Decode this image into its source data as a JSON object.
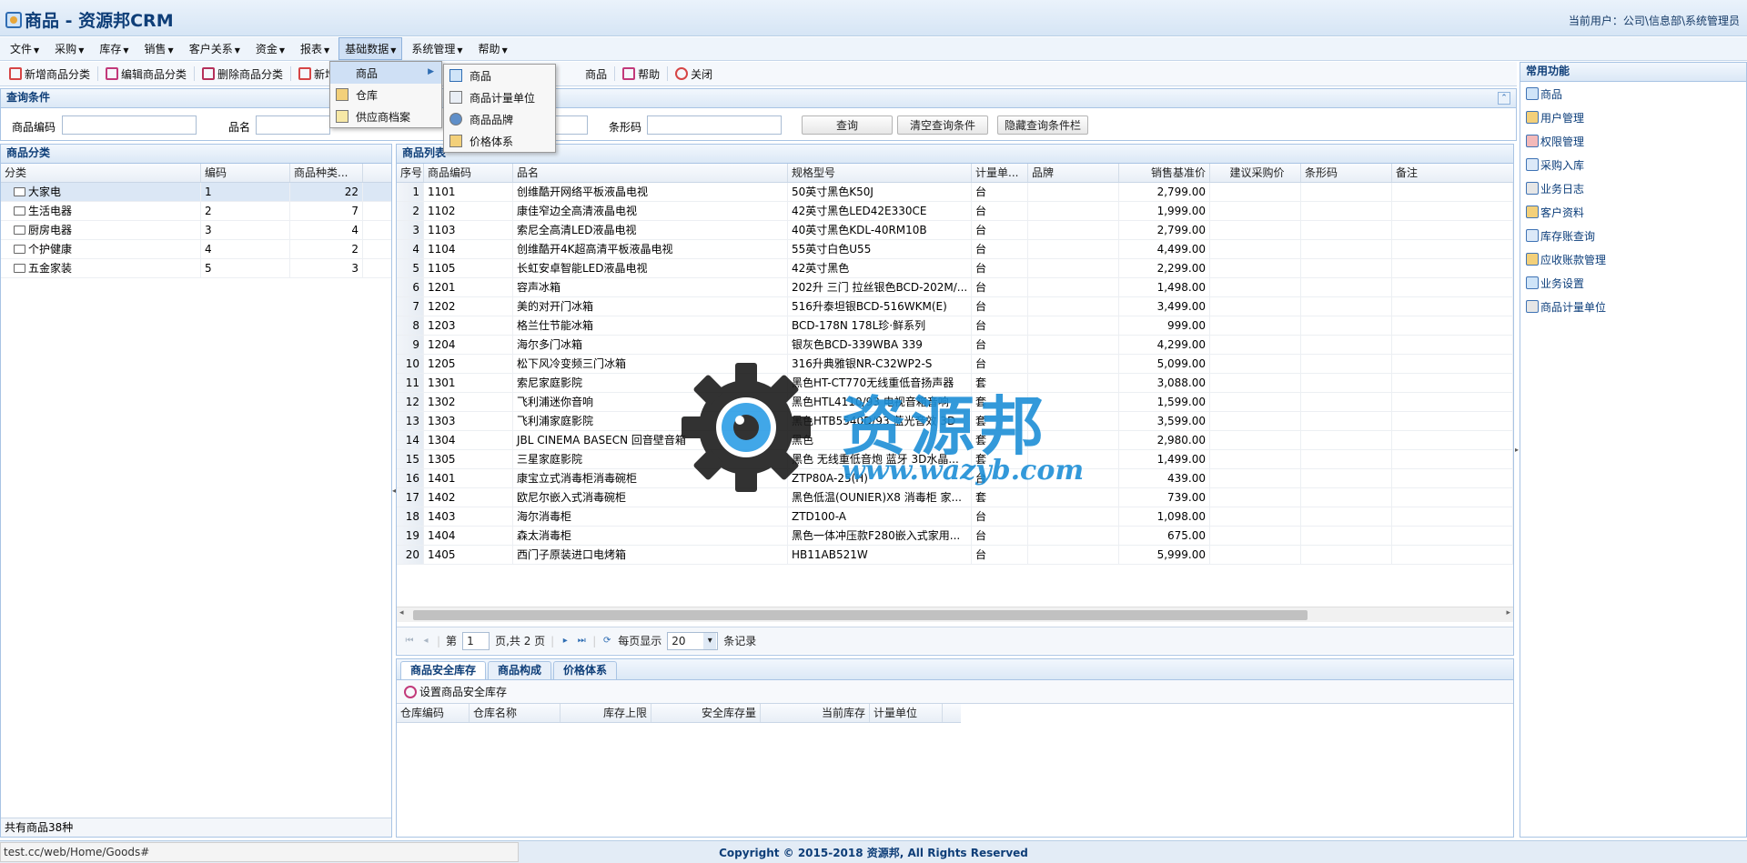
{
  "app": {
    "title": "商品 - 资源邦CRM",
    "user": "当前用户：公司\\信息部\\系统管理员"
  },
  "menu": [
    {
      "label": "文件"
    },
    {
      "label": "采购"
    },
    {
      "label": "库存"
    },
    {
      "label": "销售"
    },
    {
      "label": "客户关系"
    },
    {
      "label": "资金"
    },
    {
      "label": "报表"
    },
    {
      "label": "基础数据"
    },
    {
      "label": "系统管理"
    },
    {
      "label": "帮助"
    }
  ],
  "toolbar": {
    "add_category": "新增商品分类",
    "edit_category": "编辑商品分类",
    "delete_category": "删除商品分类",
    "add_goods": "新增",
    "goods_partial": "商品",
    "help": "帮助",
    "close": "关闭"
  },
  "dropdown": {
    "level1": [
      {
        "label": "商品"
      },
      {
        "label": "仓库"
      },
      {
        "label": "供应商档案"
      }
    ],
    "level2": [
      {
        "label": "商品"
      },
      {
        "label": "商品计量单位"
      },
      {
        "label": "商品品牌"
      },
      {
        "label": "价格体系"
      }
    ]
  },
  "query": {
    "title": "查询条件",
    "code_label": "商品编码",
    "name_label": "品名",
    "barcode_label": "条形码",
    "search": "查询",
    "clear": "清空查询条件",
    "hide": "隐藏查询条件栏"
  },
  "category": {
    "title": "商品分类",
    "headers": [
      "分类",
      "编码",
      "商品种类..."
    ],
    "rows": [
      {
        "name": "大家电",
        "code": "1",
        "count": "22"
      },
      {
        "name": "生活电器",
        "code": "2",
        "count": "7"
      },
      {
        "name": "厨房电器",
        "code": "3",
        "count": "4"
      },
      {
        "name": "个护健康",
        "code": "4",
        "count": "2"
      },
      {
        "name": "五金家装",
        "code": "5",
        "count": "3"
      }
    ],
    "footer": "共有商品38种"
  },
  "goods": {
    "title": "商品列表",
    "headers": [
      "序号",
      "商品编码",
      "品名",
      "规格型号",
      "计量单...",
      "品牌",
      "销售基准价",
      "建议采购价",
      "条形码",
      "备注"
    ],
    "rows": [
      {
        "no": "1",
        "code": "1101",
        "name": "创维酷开网络平板液晶电视",
        "spec": "50英寸黑色K50J",
        "unit": "台",
        "price": "2,799.00"
      },
      {
        "no": "2",
        "code": "1102",
        "name": "康佳窄边全高清液晶电视",
        "spec": "42英寸黑色LED42E330CE",
        "unit": "台",
        "price": "1,999.00"
      },
      {
        "no": "3",
        "code": "1103",
        "name": "索尼全高清LED液晶电视",
        "spec": "40英寸黑色KDL-40RM10B",
        "unit": "台",
        "price": "2,799.00"
      },
      {
        "no": "4",
        "code": "1104",
        "name": "创维酷开4K超高清平板液晶电视",
        "spec": "55英寸白色U55",
        "unit": "台",
        "price": "4,499.00"
      },
      {
        "no": "5",
        "code": "1105",
        "name": "长虹安卓智能LED液晶电视",
        "spec": "42英寸黑色",
        "unit": "台",
        "price": "2,299.00"
      },
      {
        "no": "6",
        "code": "1201",
        "name": "容声冰箱",
        "spec": "202升 三门 拉丝银色BCD-202M/...",
        "unit": "台",
        "price": "1,498.00"
      },
      {
        "no": "7",
        "code": "1202",
        "name": "美的对开门冰箱",
        "spec": "516升泰坦银BCD-516WKM(E)",
        "unit": "台",
        "price": "3,499.00"
      },
      {
        "no": "8",
        "code": "1203",
        "name": "格兰仕节能冰箱",
        "spec": "BCD-178N 178L珍·鲜系列",
        "unit": "台",
        "price": "999.00"
      },
      {
        "no": "9",
        "code": "1204",
        "name": "海尔多门冰箱",
        "spec": "银灰色BCD-339WBA 339",
        "unit": "台",
        "price": "4,299.00"
      },
      {
        "no": "10",
        "code": "1205",
        "name": "松下风冷变频三门冰箱",
        "spec": "316升典雅银NR-C32WP2-S",
        "unit": "台",
        "price": "5,099.00"
      },
      {
        "no": "11",
        "code": "1301",
        "name": "索尼家庭影院",
        "spec": "黑色HT-CT770无线重低音扬声器",
        "unit": "套",
        "price": "3,088.00"
      },
      {
        "no": "12",
        "code": "1302",
        "name": "飞利浦迷你音响",
        "spec": "黑色HTL4110/93 电视音箱音响",
        "unit": "套",
        "price": "1,599.00"
      },
      {
        "no": "13",
        "code": "1303",
        "name": "飞利浦家庭影院",
        "spec": "黑色HTB5540D/93 蓝光音效 3D",
        "unit": "套",
        "price": "3,599.00"
      },
      {
        "no": "14",
        "code": "1304",
        "name": "JBL CINEMA BASECN 回音壁音箱",
        "spec": "黑色",
        "unit": "套",
        "price": "2,980.00"
      },
      {
        "no": "15",
        "code": "1305",
        "name": "三星家庭影院",
        "spec": "黑色 无线重低音炮 蓝牙 3D水晶...",
        "unit": "套",
        "price": "1,499.00"
      },
      {
        "no": "16",
        "code": "1401",
        "name": "康宝立式消毒柜消毒碗柜",
        "spec": "ZTP80A-25(H)",
        "unit": "台",
        "price": "439.00"
      },
      {
        "no": "17",
        "code": "1402",
        "name": "欧尼尔嵌入式消毒碗柜",
        "spec": "黑色低温(OUNIER)X8 消毒柜 家...",
        "unit": "套",
        "price": "739.00"
      },
      {
        "no": "18",
        "code": "1403",
        "name": "海尔消毒柜",
        "spec": "ZTD100-A",
        "unit": "台",
        "price": "1,098.00"
      },
      {
        "no": "19",
        "code": "1404",
        "name": "森太消毒柜",
        "spec": "黑色一体冲压款F280嵌入式家用...",
        "unit": "台",
        "price": "675.00"
      },
      {
        "no": "20",
        "code": "1405",
        "name": "西门子原装进口电烤箱",
        "spec": "HB11AB521W",
        "unit": "台",
        "price": "5,999.00"
      }
    ]
  },
  "pager": {
    "page_prefix": "第",
    "page_value": "1",
    "page_suffix": "页,共 2 页",
    "per_page_label": "每页显示",
    "per_page_value": "20",
    "records_label": "条记录"
  },
  "bottom": {
    "tabs": [
      "商品安全库存",
      "商品构成",
      "价格体系"
    ],
    "set_button": "设置商品安全库存",
    "headers": [
      "仓库编码",
      "仓库名称",
      "库存上限",
      "安全库存量",
      "当前库存",
      "计量单位"
    ]
  },
  "sidebar": {
    "title": "常用功能",
    "items": [
      {
        "label": "商品"
      },
      {
        "label": "用户管理"
      },
      {
        "label": "权限管理"
      },
      {
        "label": "采购入库"
      },
      {
        "label": "业务日志"
      },
      {
        "label": "客户资料"
      },
      {
        "label": "库存账查询"
      },
      {
        "label": "应收账款管理"
      },
      {
        "label": "业务设置"
      },
      {
        "label": "商品计量单位"
      }
    ]
  },
  "status": {
    "url": "test.cc/web/Home/Goods#",
    "copyright": "Copyright © 2015-2018 资源邦, All Rights Reserved"
  },
  "watermark": {
    "text": "资源邦",
    "url": "www.wazyb.com"
  }
}
